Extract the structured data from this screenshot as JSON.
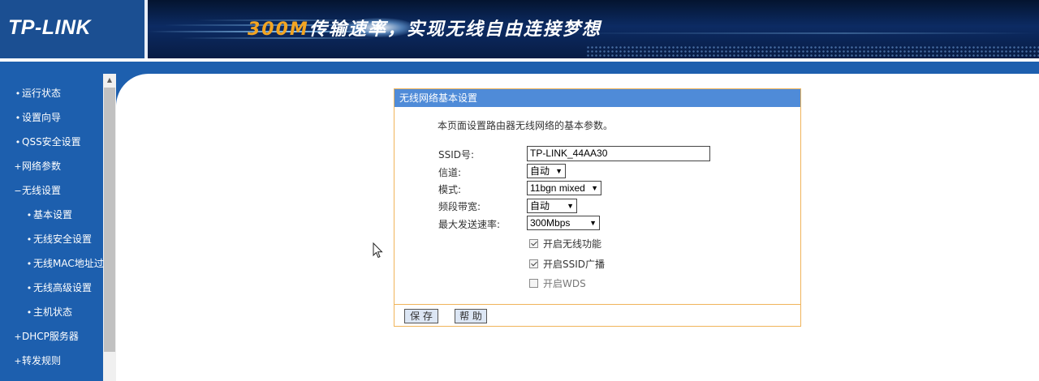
{
  "header": {
    "logo": "TP-LINK",
    "slogan_highlight": "300M",
    "slogan_rest": "传输速率，实现无线自由连接梦想"
  },
  "sidebar": {
    "items": [
      {
        "bullet": "•",
        "label": "运行状态",
        "level": 0
      },
      {
        "bullet": "•",
        "label": "设置向导",
        "level": 0
      },
      {
        "bullet": "•",
        "label": "QSS安全设置",
        "level": 0
      },
      {
        "bullet": "+",
        "label": "网络参数",
        "level": 0
      },
      {
        "bullet": "−",
        "label": "无线设置",
        "level": 0
      },
      {
        "bullet": "•",
        "label": "基本设置",
        "level": 1
      },
      {
        "bullet": "•",
        "label": "无线安全设置",
        "level": 1
      },
      {
        "bullet": "•",
        "label": "无线MAC地址过滤",
        "level": 1
      },
      {
        "bullet": "•",
        "label": "无线高级设置",
        "level": 1
      },
      {
        "bullet": "•",
        "label": "主机状态",
        "level": 1
      },
      {
        "bullet": "+",
        "label": "DHCP服务器",
        "level": 0
      },
      {
        "bullet": "+",
        "label": "转发规则",
        "level": 0
      }
    ]
  },
  "panel": {
    "title": "无线网络基本设置",
    "description": "本页面设置路由器无线网络的基本参数。",
    "ssid_label": "SSID号:",
    "ssid_value": "TP-LINK_44AA30",
    "channel_label": "信道:",
    "channel_value": "自动",
    "mode_label": "模式:",
    "mode_value": "11bgn mixed",
    "bandwidth_label": "频段带宽:",
    "bandwidth_value": "自动",
    "rate_label": "最大发送速率:",
    "rate_value": "300Mbps",
    "enable_wireless_label": "开启无线功能",
    "enable_wireless_checked": true,
    "enable_ssid_broadcast_label": "开启SSID广播",
    "enable_ssid_broadcast_checked": true,
    "enable_wds_label": "开启WDS",
    "enable_wds_checked": false,
    "save_label": "保 存",
    "help_label": "帮 助"
  },
  "colors": {
    "nav_blue": "#1d5fae",
    "panel_title_blue": "#4f8bd8",
    "panel_border_orange": "#f0b45a",
    "slogan_orange": "#f3a522"
  }
}
